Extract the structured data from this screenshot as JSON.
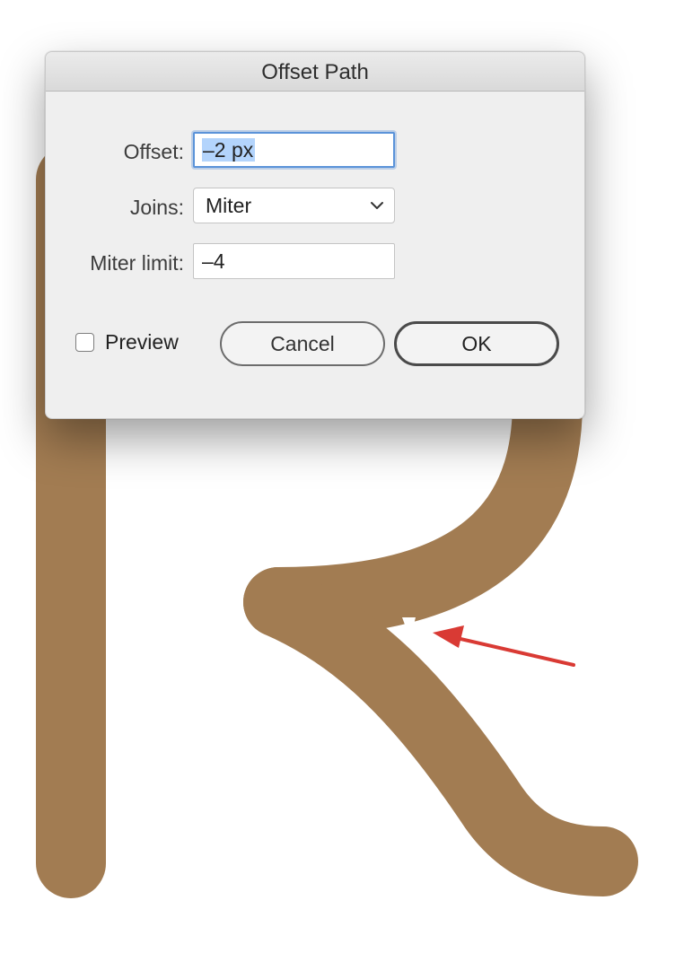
{
  "colors": {
    "stroke": "#a27c52",
    "arrow": "#d93a34",
    "focus_ring": "#5b93d9",
    "selection": "#b3d4fc"
  },
  "dialog": {
    "title": "Offset Path",
    "offset": {
      "label": "Offset:",
      "value": "–2 px"
    },
    "joins": {
      "label": "Joins:",
      "value": "Miter",
      "icon": "chevron-down-icon"
    },
    "miter_limit": {
      "label": "Miter limit:",
      "value": "–4"
    },
    "preview": {
      "label": "Preview",
      "checked": false
    },
    "buttons": {
      "cancel": "Cancel",
      "ok": "OK"
    }
  }
}
